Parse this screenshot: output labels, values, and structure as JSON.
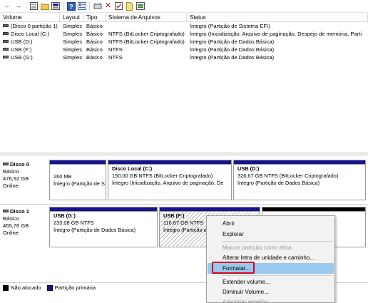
{
  "toolbar": {
    "icons": [
      "back-arrow-icon",
      "forward-arrow-icon",
      "list-view-icon",
      "help-icon",
      "properties-icon",
      "folder-icon",
      "delete-icon",
      "document-icon",
      "refresh-icon",
      "disk-view-icon"
    ]
  },
  "table": {
    "headers": {
      "volume": "Volume",
      "layout": "Layout",
      "type": "Tipo",
      "fs": "Sistema de Arquivos",
      "status": "Status"
    },
    "rows": [
      {
        "volume": "(Disco 0 partição 1)",
        "layout": "Simples",
        "type": "Básico",
        "fs": "",
        "status": "Íntegro (Partição de Sistema EFI)"
      },
      {
        "volume": "Disco Local (C:)",
        "layout": "Simples",
        "type": "Básico",
        "fs": "NTFS (BitLocker Criptografado)",
        "status": "Íntegro (Inicialização, Arquivo de paginação, Despejo de memória, Parti"
      },
      {
        "volume": "USB (D:)",
        "layout": "Simples",
        "type": "Básico",
        "fs": "NTFS (BitLocker Criptografado)",
        "status": "Íntegro (Partição de Dados Básica)"
      },
      {
        "volume": "USB (F:)",
        "layout": "Simples",
        "type": "Básico",
        "fs": "NTFS",
        "status": "Íntegro (Partição de Dados Básica)"
      },
      {
        "volume": "USB (G:)",
        "layout": "Simples",
        "type": "Básico",
        "fs": "NTFS",
        "status": "Íntegro (Partição de Dados Básica)"
      }
    ]
  },
  "disks": [
    {
      "name": "Disco 0",
      "type": "Básico",
      "size": "476,92 GB",
      "state": "Online",
      "partitions": [
        {
          "name": "",
          "size": "260 MB",
          "status": "Íntegro (Partição de S"
        },
        {
          "name": "Disco Local  (C:)",
          "size": "150,00 GB NTFS (BitLocker Criptografado)",
          "status": "Íntegro (Inicialização, Arquivo de paginação, De"
        },
        {
          "name": "USB  (D:)",
          "size": "326,67 GB NTFS (BitLocker Criptografado)",
          "status": "Íntegro (Partição de Dados Básica)"
        }
      ]
    },
    {
      "name": "Disco 1",
      "type": "Básico",
      "size": "465,76 GB",
      "state": "Online",
      "partitions": [
        {
          "name": "USB  (G:)",
          "size": "233,08 GB NTFS",
          "status": "Íntegro (Partição de Dados Básica)"
        },
        {
          "name": "USB  (F:)",
          "size": "116,67 GB NTFS",
          "status": "Íntegro (Partição de"
        }
      ]
    }
  ],
  "legend": {
    "unallocated": "Não alocado",
    "primary": "Partição primária"
  },
  "colors": {
    "primary_bar": "#14148f",
    "unallocated_bar": "#000000",
    "menu_highlight": "#99c9ef",
    "focus_box": "#d9001b"
  },
  "context_menu": {
    "open": "Abrir",
    "explore": "Explorar",
    "mark_active": "Marcar partição como ativa",
    "change_letter": "Alterar letra de unidade e caminho...",
    "format": "Formatar...",
    "extend": "Estender volume...",
    "shrink": "Diminuir Volume...",
    "add_mirror": "Adicionar espelho..."
  }
}
